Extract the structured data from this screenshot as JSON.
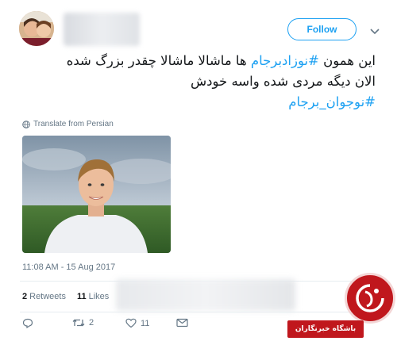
{
  "header": {
    "follow_label": "Follow"
  },
  "tweet": {
    "lines": [
      {
        "pre": "این همون ",
        "tag": "#نوزادبرجام",
        "post": " ها ماشالا ماشالا چقدر بزرگ شده"
      },
      {
        "pre": "الان دیگه مردی شده واسه خودش",
        "tag": "",
        "post": ""
      },
      {
        "pre": "",
        "tag": "#نوجوان_برجام",
        "post": ""
      }
    ],
    "translate_label": "Translate from Persian",
    "timestamp": "11:08 AM - 15 Aug 2017"
  },
  "stats": {
    "retweets_count": "2",
    "retweets_label": "Retweets",
    "likes_count": "11",
    "likes_label": "Likes"
  },
  "actions": {
    "reply_count": "",
    "retweet_count": "2",
    "like_count": "11"
  },
  "watermark": {
    "text": "باشگاه خبرنگاران"
  },
  "colors": {
    "accent": "#1da1f2",
    "muted": "#657786",
    "brand_red": "#c0171d"
  },
  "icons": [
    "globe-icon",
    "chevron-down-icon",
    "reply-icon",
    "retweet-icon",
    "heart-icon",
    "envelope-icon"
  ]
}
